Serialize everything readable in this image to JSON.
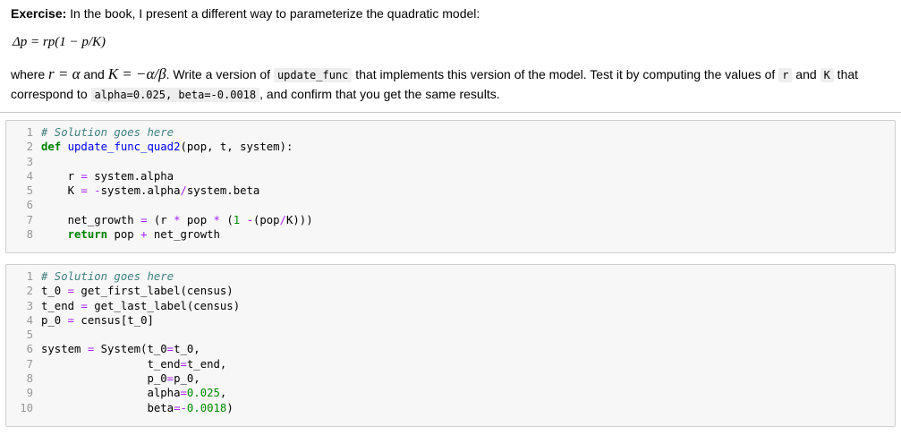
{
  "markdown": {
    "p1_bold": "Exercise:",
    "p1_text": " In the book, I present a different way to parameterize the quadratic model:",
    "formula": "Δp = rp(1 − p/K)",
    "p2": {
      "t1": "where ",
      "m1": "r = α",
      "t2": " and ",
      "m2": "K = −α/β",
      "t3": ". Write a version of ",
      "c1": "update_func",
      "t4": " that implements this version of the model. Test it by computing the values of ",
      "c2": "r",
      "t5": " and ",
      "c3": "K",
      "t6": " that correspond to ",
      "c4": "alpha=0.025, beta=-0.0018",
      "t7": ", and confirm that you get the same results."
    }
  },
  "cells": [
    {
      "lines": [
        [
          {
            "t": "# Solution goes here",
            "c": "cm"
          }
        ],
        [
          {
            "t": "def",
            "c": "kw"
          },
          {
            "t": " ",
            "c": "tx"
          },
          {
            "t": "update_func_quad2",
            "c": "fn"
          },
          {
            "t": "(pop, t, system):",
            "c": "tx"
          }
        ],
        [],
        [
          {
            "t": "    r ",
            "c": "tx"
          },
          {
            "t": "=",
            "c": "op"
          },
          {
            "t": " system.alpha",
            "c": "tx"
          }
        ],
        [
          {
            "t": "    K ",
            "c": "tx"
          },
          {
            "t": "=",
            "c": "op"
          },
          {
            "t": " ",
            "c": "tx"
          },
          {
            "t": "-",
            "c": "op"
          },
          {
            "t": "system.alpha",
            "c": "tx"
          },
          {
            "t": "/",
            "c": "op"
          },
          {
            "t": "system.beta",
            "c": "tx"
          }
        ],
        [],
        [
          {
            "t": "    net_growth ",
            "c": "tx"
          },
          {
            "t": "=",
            "c": "op"
          },
          {
            "t": " (r ",
            "c": "tx"
          },
          {
            "t": "*",
            "c": "op"
          },
          {
            "t": " pop ",
            "c": "tx"
          },
          {
            "t": "*",
            "c": "op"
          },
          {
            "t": " (",
            "c": "tx"
          },
          {
            "t": "1",
            "c": "nu"
          },
          {
            "t": " ",
            "c": "tx"
          },
          {
            "t": "-",
            "c": "op"
          },
          {
            "t": "(pop",
            "c": "tx"
          },
          {
            "t": "/",
            "c": "op"
          },
          {
            "t": "K)))",
            "c": "tx"
          }
        ],
        [
          {
            "t": "    ",
            "c": "tx"
          },
          {
            "t": "return",
            "c": "kw"
          },
          {
            "t": " pop ",
            "c": "tx"
          },
          {
            "t": "+",
            "c": "op"
          },
          {
            "t": " net_growth",
            "c": "tx"
          }
        ]
      ]
    },
    {
      "lines": [
        [
          {
            "t": "# Solution goes here",
            "c": "cm"
          }
        ],
        [
          {
            "t": "t_0 ",
            "c": "tx"
          },
          {
            "t": "=",
            "c": "op"
          },
          {
            "t": " get_first_label(census)",
            "c": "tx"
          }
        ],
        [
          {
            "t": "t_end ",
            "c": "tx"
          },
          {
            "t": "=",
            "c": "op"
          },
          {
            "t": " get_last_label(census)",
            "c": "tx"
          }
        ],
        [
          {
            "t": "p_0 ",
            "c": "tx"
          },
          {
            "t": "=",
            "c": "op"
          },
          {
            "t": " census[t_0]",
            "c": "tx"
          }
        ],
        [],
        [
          {
            "t": "system ",
            "c": "tx"
          },
          {
            "t": "=",
            "c": "op"
          },
          {
            "t": " System(t_0",
            "c": "tx"
          },
          {
            "t": "=",
            "c": "op"
          },
          {
            "t": "t_0,",
            "c": "tx"
          }
        ],
        [
          {
            "t": "                t_end",
            "c": "tx"
          },
          {
            "t": "=",
            "c": "op"
          },
          {
            "t": "t_end,",
            "c": "tx"
          }
        ],
        [
          {
            "t": "                p_0",
            "c": "tx"
          },
          {
            "t": "=",
            "c": "op"
          },
          {
            "t": "p_0,",
            "c": "tx"
          }
        ],
        [
          {
            "t": "                alpha",
            "c": "tx"
          },
          {
            "t": "=",
            "c": "op"
          },
          {
            "t": "0.025",
            "c": "nu"
          },
          {
            "t": ",",
            "c": "tx"
          }
        ],
        [
          {
            "t": "                beta",
            "c": "tx"
          },
          {
            "t": "=",
            "c": "op"
          },
          {
            "t": "-",
            "c": "op"
          },
          {
            "t": "0.0018",
            "c": "nu"
          },
          {
            "t": ")",
            "c": "tx"
          }
        ]
      ]
    }
  ]
}
